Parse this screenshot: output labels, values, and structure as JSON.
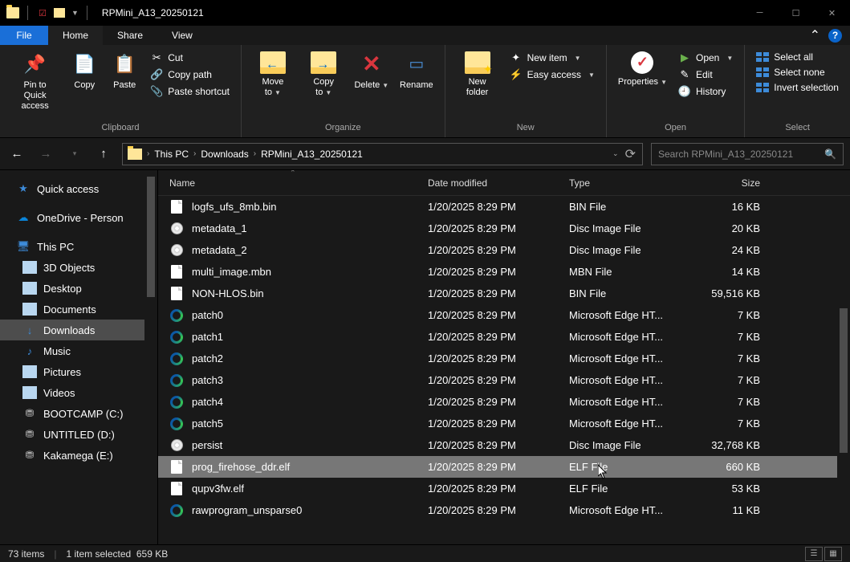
{
  "window": {
    "title": "RPMini_A13_20250121"
  },
  "menu": {
    "file": "File",
    "home": "Home",
    "share": "Share",
    "view": "View"
  },
  "ribbon": {
    "clipboard": {
      "label": "Clipboard",
      "pin": "Pin to Quick access",
      "copy": "Copy",
      "paste": "Paste",
      "cut": "Cut",
      "copy_path": "Copy path",
      "paste_shortcut": "Paste shortcut"
    },
    "organize": {
      "label": "Organize",
      "move": "Move to",
      "copy": "Copy to",
      "delete": "Delete",
      "rename": "Rename"
    },
    "new": {
      "label": "New",
      "new_folder": "New folder",
      "new_item": "New item",
      "easy": "Easy access"
    },
    "open": {
      "label": "Open",
      "properties": "Properties",
      "open": "Open",
      "edit": "Edit",
      "history": "History"
    },
    "select": {
      "label": "Select",
      "all": "Select all",
      "none": "Select none",
      "invert": "Invert selection"
    }
  },
  "breadcrumb": {
    "pc": "This PC",
    "dl": "Downloads",
    "folder": "RPMini_A13_20250121"
  },
  "search": {
    "placeholder": "Search RPMini_A13_20250121"
  },
  "sidebar": {
    "quick": "Quick access",
    "onedrive": "OneDrive - Person",
    "thispc": "This PC",
    "s1": "3D Objects",
    "s2": "Desktop",
    "s3": "Documents",
    "s4": "Downloads",
    "s5": "Music",
    "s6": "Pictures",
    "s7": "Videos",
    "s8": "BOOTCAMP (C:)",
    "s9": "UNTITLED (D:)",
    "s10": "Kakamega (E:)"
  },
  "columns": {
    "name": "Name",
    "date": "Date modified",
    "type": "Type",
    "size": "Size"
  },
  "files": [
    {
      "icon": "file",
      "name": "logfs_ufs_8mb.bin",
      "date": "1/20/2025 8:29 PM",
      "type": "BIN File",
      "size": "16 KB"
    },
    {
      "icon": "disc",
      "name": "metadata_1",
      "date": "1/20/2025 8:29 PM",
      "type": "Disc Image File",
      "size": "20 KB"
    },
    {
      "icon": "disc",
      "name": "metadata_2",
      "date": "1/20/2025 8:29 PM",
      "type": "Disc Image File",
      "size": "24 KB"
    },
    {
      "icon": "file",
      "name": "multi_image.mbn",
      "date": "1/20/2025 8:29 PM",
      "type": "MBN File",
      "size": "14 KB"
    },
    {
      "icon": "file",
      "name": "NON-HLOS.bin",
      "date": "1/20/2025 8:29 PM",
      "type": "BIN File",
      "size": "59,516 KB"
    },
    {
      "icon": "edge",
      "name": "patch0",
      "date": "1/20/2025 8:29 PM",
      "type": "Microsoft Edge HT...",
      "size": "7 KB"
    },
    {
      "icon": "edge",
      "name": "patch1",
      "date": "1/20/2025 8:29 PM",
      "type": "Microsoft Edge HT...",
      "size": "7 KB"
    },
    {
      "icon": "edge",
      "name": "patch2",
      "date": "1/20/2025 8:29 PM",
      "type": "Microsoft Edge HT...",
      "size": "7 KB"
    },
    {
      "icon": "edge",
      "name": "patch3",
      "date": "1/20/2025 8:29 PM",
      "type": "Microsoft Edge HT...",
      "size": "7 KB"
    },
    {
      "icon": "edge",
      "name": "patch4",
      "date": "1/20/2025 8:29 PM",
      "type": "Microsoft Edge HT...",
      "size": "7 KB"
    },
    {
      "icon": "edge",
      "name": "patch5",
      "date": "1/20/2025 8:29 PM",
      "type": "Microsoft Edge HT...",
      "size": "7 KB"
    },
    {
      "icon": "disc",
      "name": "persist",
      "date": "1/20/2025 8:29 PM",
      "type": "Disc Image File",
      "size": "32,768 KB"
    },
    {
      "icon": "file",
      "name": "prog_firehose_ddr.elf",
      "date": "1/20/2025 8:29 PM",
      "type": "ELF File",
      "size": "660 KB",
      "selected": true
    },
    {
      "icon": "file",
      "name": "qupv3fw.elf",
      "date": "1/20/2025 8:29 PM",
      "type": "ELF File",
      "size": "53 KB"
    },
    {
      "icon": "edge",
      "name": "rawprogram_unsparse0",
      "date": "1/20/2025 8:29 PM",
      "type": "Microsoft Edge HT...",
      "size": "11 KB"
    }
  ],
  "status": {
    "items": "73 items",
    "sel": "1 item selected",
    "size": "659 KB"
  }
}
